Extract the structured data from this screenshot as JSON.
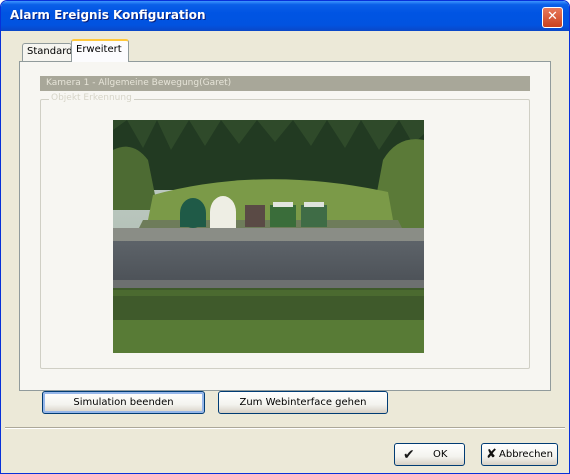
{
  "window": {
    "title": "Alarm Ereignis Konfiguration",
    "close_glyph": "✕"
  },
  "tabs": [
    {
      "label": "Standard",
      "active": false
    },
    {
      "label": "Erweitert",
      "active": true
    }
  ],
  "panel": {
    "camera_label": "Kamera 1 - Allgemeine Bewegung(Garet)",
    "group_label": "Objekt Erkennung",
    "image_description_icon": "camera-snapshot"
  },
  "buttons": {
    "simulation": "Simulation beenden",
    "webinterface": "Zum Webinterface gehen",
    "ok": "OK",
    "ok_icon": "✔",
    "cancel": "Abbrechen",
    "cancel_icon": "✘"
  },
  "colors": {
    "titlebar": "#0054e3",
    "window_bg": "#ece9d8",
    "button_border": "#003c74"
  }
}
